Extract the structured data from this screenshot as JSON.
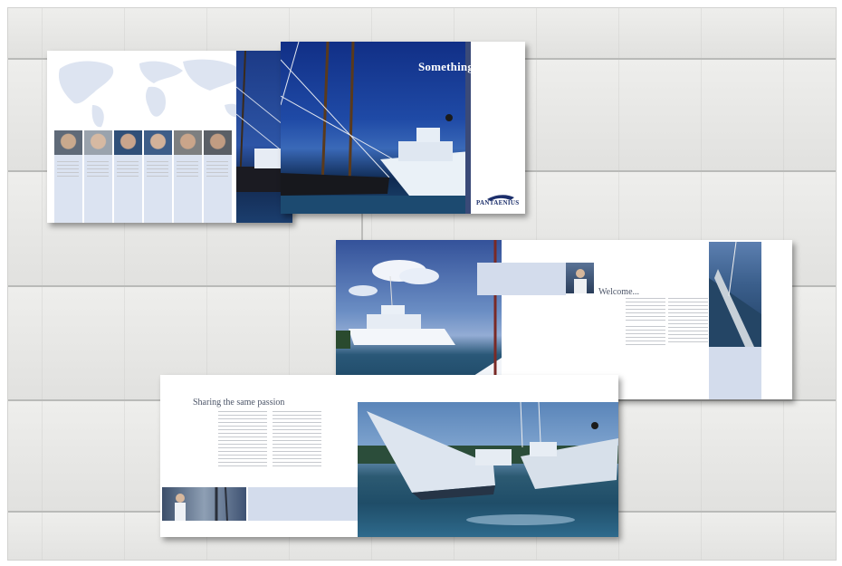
{
  "spreads": {
    "top": {
      "headline": "Something special.",
      "headline_sub": "",
      "logo_text": "PANTAENIUS",
      "logo_sub": ""
    },
    "middle": {
      "heading": "Welcome...",
      "signature": ""
    },
    "bottom": {
      "heading": "Sharing the same passion"
    }
  },
  "colors": {
    "accent_blue": "#d3dcec",
    "navy": "#1c2f6b",
    "board": "#e6e6e4"
  },
  "icons": [
    "world-map",
    "yacht-photo",
    "portrait-photo",
    "pantaenius-logo"
  ]
}
